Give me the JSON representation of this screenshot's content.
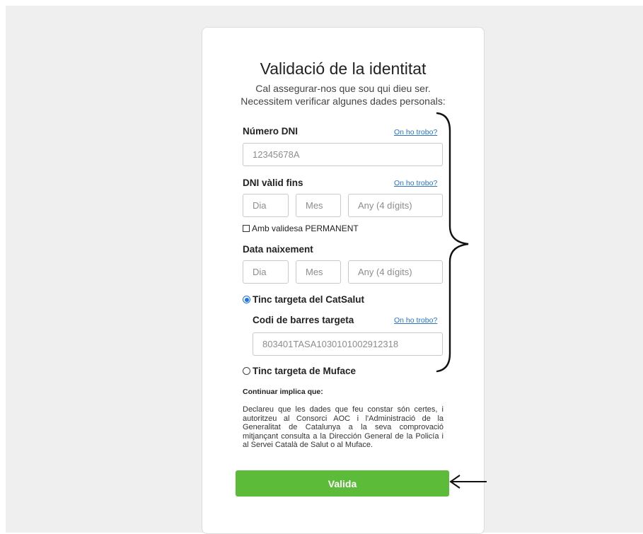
{
  "header": {
    "title": "Validació de la identitat",
    "subtitle_line1": "Cal assegurar-nos que sou qui dieu ser.",
    "subtitle_line2": "Necessitem verificar algunes dades personals:"
  },
  "dni": {
    "label": "Número DNI",
    "help": "On ho trobo?",
    "placeholder": "12345678A"
  },
  "dni_valid": {
    "label": "DNI vàlid fins",
    "help": "On ho trobo?",
    "day_placeholder": "Dia",
    "month_placeholder": "Mes",
    "year_placeholder": "Any (4 dígits)",
    "permanent_label": "Amb validesa PERMANENT"
  },
  "birth": {
    "label": "Data naixement",
    "day_placeholder": "Dia",
    "month_placeholder": "Mes",
    "year_placeholder": "Any (4 dígits)"
  },
  "catsalut": {
    "radio_label": "Tinc targeta del CatSalut",
    "selected": true,
    "barcode_label": "Codi de barres targeta",
    "help": "On ho trobo?",
    "barcode_placeholder": "803401TASA1030101002912318"
  },
  "muface": {
    "radio_label": "Tinc targeta de Muface",
    "selected": false
  },
  "notice": {
    "title": "Continuar implica que:",
    "text": "Declareu que les dades que feu constar són certes, i autoritzeu al Consorci AOC i l'Administració de la Generalitat de Catalunya a la seva comprovació mitjançant consulta a la Dirección General de la Policía i al Servei Català de Salut o al Muface."
  },
  "submit": {
    "label": "Valida",
    "color": "#5dbb3a"
  }
}
